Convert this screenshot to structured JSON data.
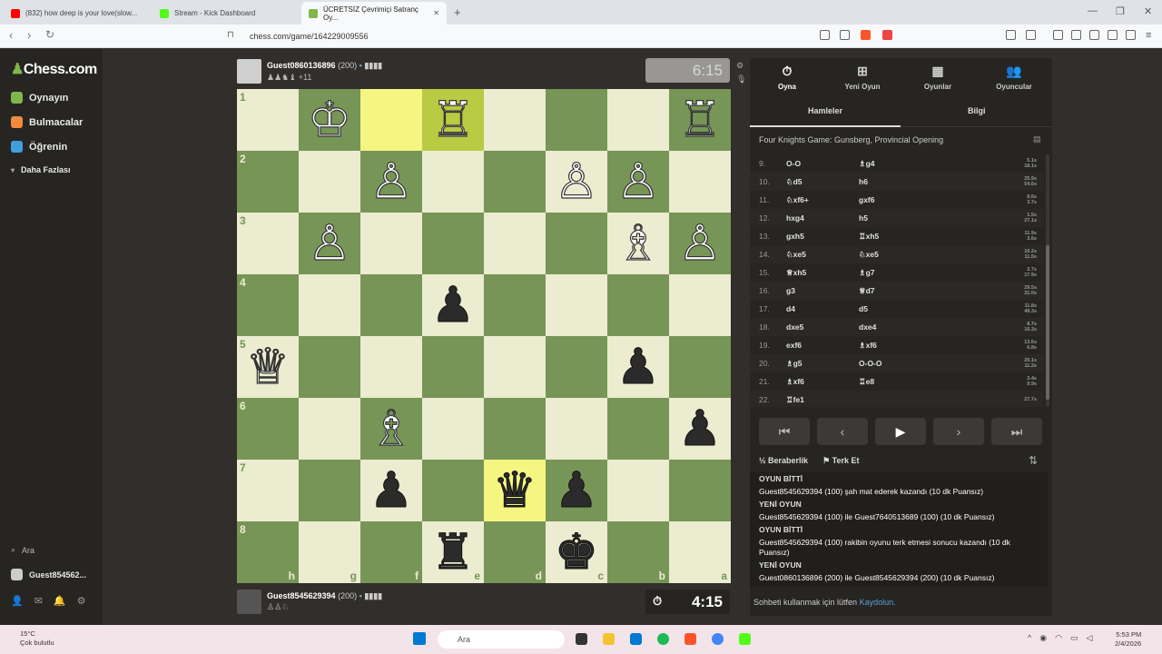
{
  "browser": {
    "tabs": [
      {
        "title": "(832) how deep is your love(slow...",
        "color": "#ff0000"
      },
      {
        "title": "Stream - Kick Dashboard",
        "color": "#53fc18"
      },
      {
        "title": "ÜCRETSİZ Çevrimiçi Satranç Oy...",
        "color": "#81b64c"
      }
    ],
    "url": "chess.com/game/164229009556"
  },
  "sidebar": {
    "logo": "Chess.com",
    "items": [
      {
        "label": "Oynayın",
        "color": "#81b64c"
      },
      {
        "label": "Bulmacalar",
        "color": "#f08a3c"
      },
      {
        "label": "Öğrenin",
        "color": "#3fa0e0"
      },
      {
        "label": "Daha Fazlası",
        "color": "#999"
      }
    ],
    "search": "Ara",
    "user": "Guest854562..."
  },
  "top_player": {
    "name": "Guest0860136896",
    "rating": "(200)",
    "advantage": "+11",
    "clock": "6:15"
  },
  "bottom_player": {
    "name": "Guest8545629394",
    "rating": "(200)",
    "clock": "4:15"
  },
  "board": {
    "ranks": [
      "1",
      "2",
      "3",
      "4",
      "5",
      "6",
      "7",
      "8"
    ],
    "files": [
      "h",
      "g",
      "f",
      "e",
      "d",
      "c",
      "b",
      "a"
    ],
    "rows": [
      [
        {
          "p": ""
        },
        {
          "p": "♔",
          "c": "w"
        },
        {
          "p": "",
          "h": 1
        },
        {
          "p": "♖",
          "c": "w",
          "h": 1
        },
        {
          "p": ""
        },
        {
          "p": ""
        },
        {
          "p": ""
        },
        {
          "p": "♖",
          "c": "w"
        }
      ],
      [
        {
          "p": ""
        },
        {
          "p": ""
        },
        {
          "p": "♙",
          "c": "w"
        },
        {
          "p": ""
        },
        {
          "p": ""
        },
        {
          "p": "♙",
          "c": "w"
        },
        {
          "p": "♙",
          "c": "w"
        },
        {
          "p": ""
        }
      ],
      [
        {
          "p": ""
        },
        {
          "p": "♙",
          "c": "w"
        },
        {
          "p": ""
        },
        {
          "p": ""
        },
        {
          "p": ""
        },
        {
          "p": ""
        },
        {
          "p": "♗",
          "c": "w"
        },
        {
          "p": "♙",
          "c": "w"
        }
      ],
      [
        {
          "p": ""
        },
        {
          "p": ""
        },
        {
          "p": ""
        },
        {
          "p": "♟",
          "c": "b"
        },
        {
          "p": ""
        },
        {
          "p": ""
        },
        {
          "p": ""
        },
        {
          "p": ""
        }
      ],
      [
        {
          "p": "♕",
          "c": "w"
        },
        {
          "p": ""
        },
        {
          "p": ""
        },
        {
          "p": ""
        },
        {
          "p": ""
        },
        {
          "p": ""
        },
        {
          "p": "♟",
          "c": "b"
        },
        {
          "p": ""
        }
      ],
      [
        {
          "p": ""
        },
        {
          "p": ""
        },
        {
          "p": "♗",
          "c": "w"
        },
        {
          "p": ""
        },
        {
          "p": ""
        },
        {
          "p": ""
        },
        {
          "p": ""
        },
        {
          "p": "♟",
          "c": "b"
        }
      ],
      [
        {
          "p": ""
        },
        {
          "p": ""
        },
        {
          "p": "♟",
          "c": "b"
        },
        {
          "p": ""
        },
        {
          "p": "♛",
          "c": "b",
          "h": 1
        },
        {
          "p": "♟",
          "c": "b"
        },
        {
          "p": ""
        },
        {
          "p": ""
        }
      ],
      [
        {
          "p": ""
        },
        {
          "p": ""
        },
        {
          "p": ""
        },
        {
          "p": "♜",
          "c": "b"
        },
        {
          "p": ""
        },
        {
          "p": "♚",
          "c": "b"
        },
        {
          "p": ""
        },
        {
          "p": ""
        }
      ]
    ]
  },
  "panel": {
    "tabs": [
      {
        "icon": "⏱",
        "label": "Oyna"
      },
      {
        "icon": "⊞",
        "label": "Yeni Oyun"
      },
      {
        "icon": "▦",
        "label": "Oyunlar"
      },
      {
        "icon": "👥",
        "label": "Oyuncular"
      }
    ],
    "subtabs": [
      "Hamleler",
      "Bilgi"
    ],
    "opening": "Four Knights Game: Gunsberg, Provincial Opening",
    "moves": [
      {
        "n": "9.",
        "w": "O-O",
        "b": "♗g4",
        "tw": "5.1s",
        "tb": "18.1s"
      },
      {
        "n": "10.",
        "w": "♘d5",
        "b": "h6",
        "tw": "25.9s",
        "tb": "54.6s"
      },
      {
        "n": "11.",
        "w": "♘xf6+",
        "b": "gxf6",
        "tw": "8.6s",
        "tb": "3.7s"
      },
      {
        "n": "12.",
        "w": "hxg4",
        "b": "h5",
        "tw": "1.5s",
        "tb": "27.1s"
      },
      {
        "n": "13.",
        "w": "gxh5",
        "b": "♖xh5",
        "tw": "11.9s",
        "tb": "3.6s"
      },
      {
        "n": "14.",
        "w": "♘xe5",
        "b": "♘xe5",
        "tw": "16.2s",
        "tb": "11.5s"
      },
      {
        "n": "15.",
        "w": "♕xh5",
        "b": "♗g7",
        "tw": "2.7s",
        "tb": "17.9s"
      },
      {
        "n": "16.",
        "w": "g3",
        "b": "♕d7",
        "tw": "29.5s",
        "tb": "31.0s"
      },
      {
        "n": "17.",
        "w": "d4",
        "b": "d5",
        "tw": "11.8s",
        "tb": "49.3s"
      },
      {
        "n": "18.",
        "w": "dxe5",
        "b": "dxe4",
        "tw": "8.7s",
        "tb": "16.2s"
      },
      {
        "n": "19.",
        "w": "exf6",
        "b": "♗xf6",
        "tw": "13.6s",
        "tb": "6.8s"
      },
      {
        "n": "20.",
        "w": "♗g5",
        "b": "O-O-O",
        "tw": "20.1s",
        "tb": "11.2s"
      },
      {
        "n": "21.",
        "w": "♗xf6",
        "b": "♖e8",
        "tw": "3.4s",
        "tb": "9.9s"
      },
      {
        "n": "22.",
        "w": "♖fe1",
        "b": "",
        "tw": "27.7s",
        "tb": ""
      }
    ],
    "controls": [
      "⏮",
      "‹",
      "▶",
      "›",
      "⏭"
    ],
    "draw": "Beraberlik",
    "resign": "Terk Et",
    "chat": [
      {
        "t": "OYUN BİTTİ",
        "m": ""
      },
      {
        "t": "",
        "m": "Guest8545629394 (100) şah mat ederek kazandı (10 dk Puansız)"
      },
      {
        "t": "YENİ OYUN",
        "m": ""
      },
      {
        "t": "",
        "m": "Guest8545629394 (100) ile Guest7640513689 (100) (10 dk Puansız)"
      },
      {
        "t": "OYUN BİTTİ",
        "m": ""
      },
      {
        "t": "",
        "m": "Guest8545629394 (100) rakibin oyunu terk etmesi sonucu kazandı (10 dk Puansız)"
      },
      {
        "t": "YENİ OYUN",
        "m": ""
      },
      {
        "t": "",
        "m": "Guest0860136896 (200) ile Guest8545629394 (200) (10 dk Puansız)"
      }
    ],
    "chat_footer": "Sohbeti kullanmak için lütfen",
    "chat_link": "Kaydolun."
  },
  "taskbar": {
    "temp": "15°C",
    "weather": "Çok bulutlu",
    "search": "Ara",
    "time": "5:53 PM",
    "date": "2/4/2026"
  }
}
